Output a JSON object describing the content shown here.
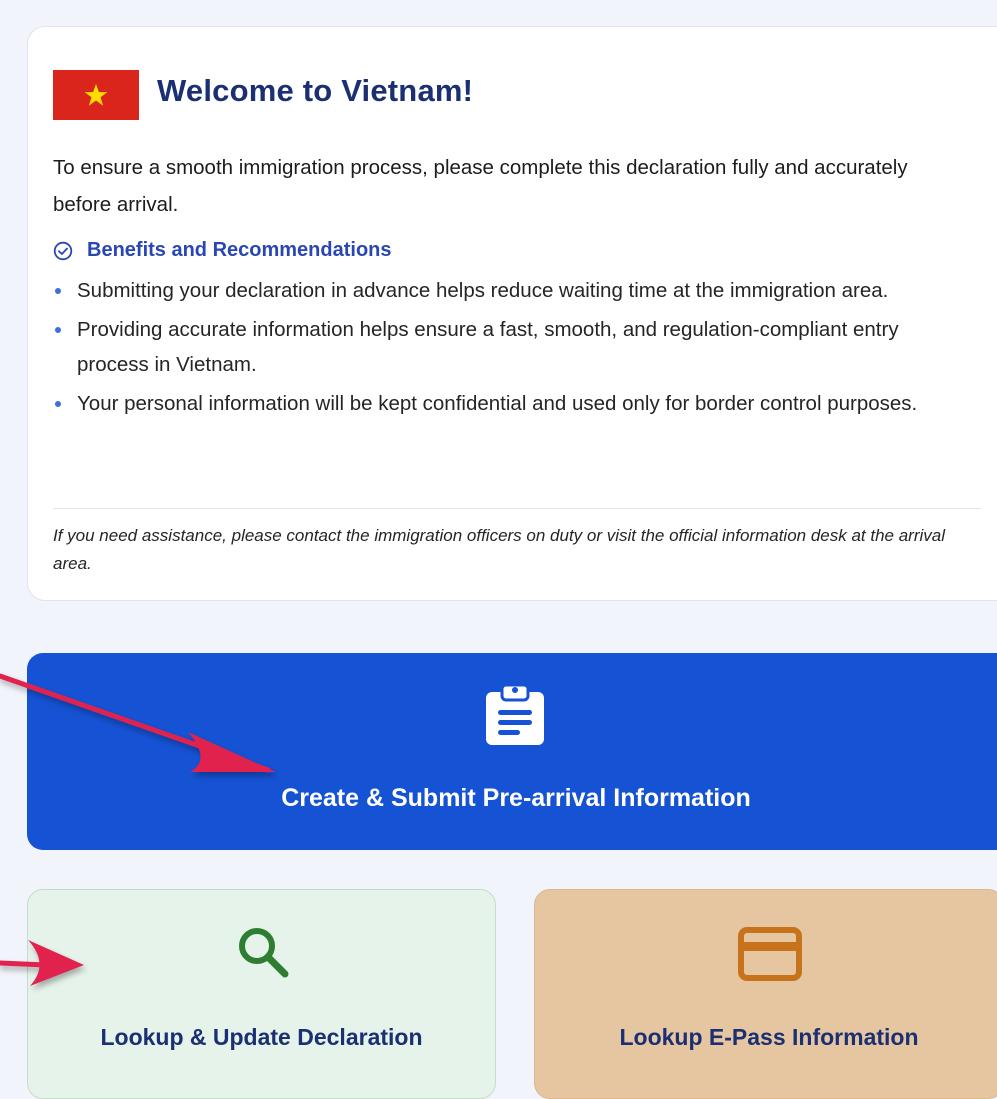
{
  "welcome": {
    "title": "Welcome to Vietnam!",
    "intro": "To ensure a smooth immigration process, please complete this declaration fully and accurately before arrival.",
    "benefits_title": "Benefits and Recommendations",
    "benefits": [
      "Submitting your declaration in advance helps reduce waiting time at the immigration area.",
      "Providing accurate information helps ensure a fast, smooth, and regulation-compliant entry process in Vietnam.",
      "Your personal information will be kept confidential and used only for border control purposes."
    ],
    "help": "If you need assistance, please contact the immigration officers on duty or visit the official information desk at the arrival area."
  },
  "actions": {
    "create": {
      "label": "Create & Submit Pre-arrival Information",
      "icon": "clipboard-icon"
    },
    "lookup": {
      "label": "Lookup & Update Declaration",
      "icon": "search-icon"
    },
    "epass": {
      "label": "Lookup E-Pass Information",
      "icon": "credit-card-icon"
    }
  },
  "colors": {
    "primary": "#1552d4",
    "title": "#1b2f73",
    "flag_red": "#da251d",
    "flag_star": "#ffde00",
    "lookup_bg": "#e6f3ea",
    "lookup_icon": "#2e7d32",
    "epass_bg": "#e6c6a0",
    "epass_icon": "#c6731b",
    "annotation_arrow": "#e0224e"
  }
}
